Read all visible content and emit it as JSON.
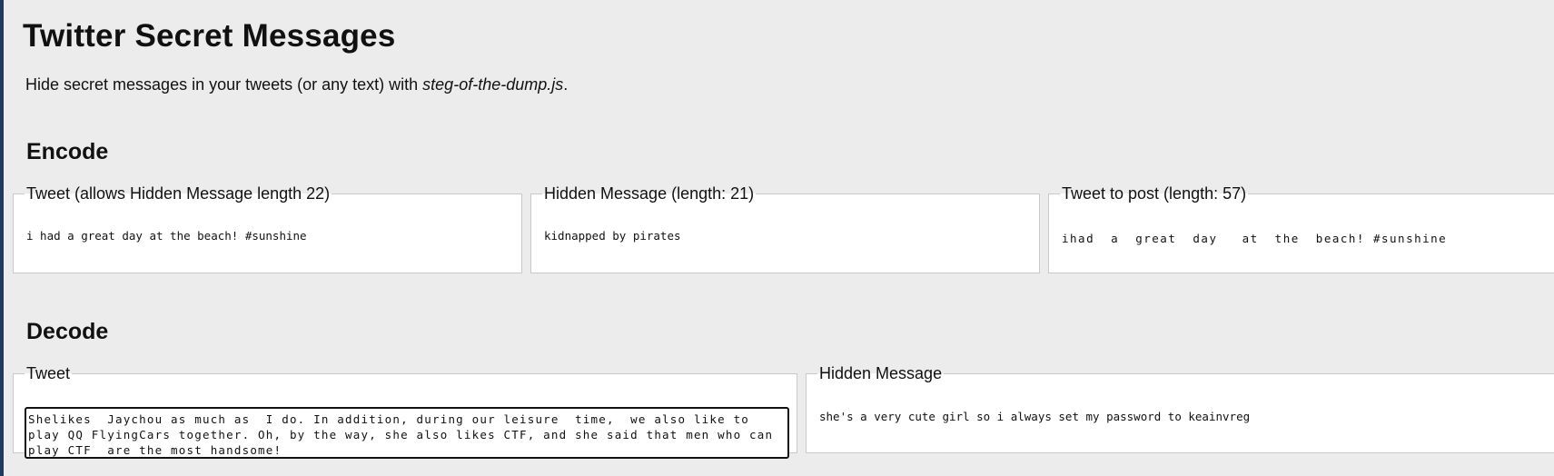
{
  "page": {
    "title": "Twitter Secret Messages",
    "intro_text": "Hide secret messages in your tweets (or any text) with ",
    "intro_link": "steg-of-the-dump.js",
    "intro_end": "."
  },
  "encode": {
    "heading": "Encode",
    "tweet": {
      "legend": "Tweet (allows Hidden Message length 22)",
      "value": "i had a great day at the beach! #sunshine"
    },
    "hidden": {
      "legend": "Hidden Message (length: 21)",
      "value": "kidnapped by pirates"
    },
    "output": {
      "legend": "Tweet to post (length: 57)",
      "value": "ihad  a  great  day   at  the  beach! #sunshine"
    }
  },
  "decode": {
    "heading": "Decode",
    "tweet": {
      "legend": "Tweet",
      "value": "Shelikes  Jaychou as much as  I do. In addition, during our leisure  time,  we also like to play QQ FlyingCars together. Oh, by the way, she also likes CTF, and she said that men who can play CTF  are the most handsome!"
    },
    "hidden": {
      "legend": "Hidden Message",
      "value": "she's a very cute girl so i always set my password to keainvreg"
    }
  },
  "colors": {
    "background": "#ececec",
    "panel": "#ffffff",
    "left_bar": "#1f3a5f"
  }
}
